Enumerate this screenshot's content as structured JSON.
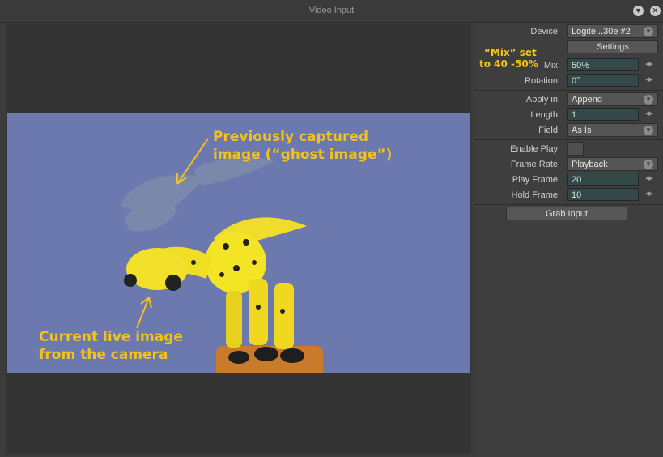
{
  "window": {
    "title": "Video Input"
  },
  "annotations": {
    "ghost": [
      "Previously captured",
      "image (“ghost image”)"
    ],
    "live": [
      "Current live image",
      "from the camera"
    ],
    "mix": [
      "“Mix” set",
      "to 40 -50%"
    ]
  },
  "panel": {
    "device": {
      "label": "Device",
      "value": "Logite...30e #2"
    },
    "settings_button": "Settings",
    "mix": {
      "label": "Mix",
      "value": "50%"
    },
    "rotation": {
      "label": "Rotation",
      "value": "0°"
    },
    "apply_in": {
      "label": "Apply in",
      "value": "Append"
    },
    "length": {
      "label": "Length",
      "value": "1"
    },
    "field": {
      "label": "Field",
      "value": "As Is"
    },
    "enable_play": {
      "label": "Enable Play"
    },
    "frame_rate": {
      "label": "Frame Rate",
      "value": "Playback"
    },
    "play_frame": {
      "label": "Play Frame",
      "value": "20"
    },
    "hold_frame": {
      "label": "Hold Frame",
      "value": "10"
    },
    "grab_button": "Grab Input"
  },
  "colors": {
    "annotation": "#f2c21b",
    "background": "#6b79ae"
  }
}
